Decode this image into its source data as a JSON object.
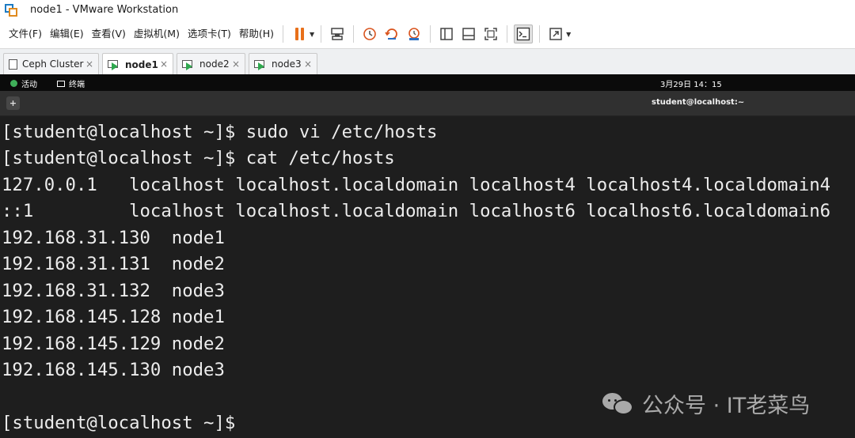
{
  "window": {
    "title": "node1 - VMware Workstation"
  },
  "menu": {
    "items": [
      "文件(F)",
      "编辑(E)",
      "查看(V)",
      "虚拟机(M)",
      "选项卡(T)",
      "帮助(H)"
    ]
  },
  "toolbar": {
    "icons": [
      "pause-icon",
      "send-keys-icon",
      "snapshot-icon",
      "revert-snapshot-icon",
      "snapshot-manager-icon",
      "sidebar-icon",
      "thumbnail-bar-icon",
      "full-screen-icon",
      "console-view-icon",
      "stretch-guest-icon"
    ],
    "accent_color": "#e8701a"
  },
  "tabs": [
    {
      "label": "Ceph Cluster",
      "active": false
    },
    {
      "label": "node1",
      "active": true
    },
    {
      "label": "node2",
      "active": false
    },
    {
      "label": "node3",
      "active": false
    }
  ],
  "tab_close_glyph": "×",
  "guest": {
    "activities_label": "活动",
    "app_label": "终端",
    "clock": "3月29日  14：15"
  },
  "terminal": {
    "title": "student@localhost:~",
    "new_tab_glyph": "+",
    "lines": [
      "[student@localhost ~]$ sudo vi /etc/hosts",
      "[student@localhost ~]$ cat /etc/hosts",
      "127.0.0.1   localhost localhost.localdomain localhost4 localhost4.localdomain4",
      "::1         localhost localhost.localdomain localhost6 localhost6.localdomain6",
      "192.168.31.130  node1",
      "192.168.31.131  node2",
      "192.168.31.132  node3",
      "192.168.145.128 node1",
      "192.168.145.129 node2",
      "192.168.145.130 node3",
      "",
      "[student@localhost ~]$"
    ],
    "background": "#1e1e1e",
    "foreground": "#ececec"
  },
  "watermark": {
    "text": "公众号 · IT老菜鸟"
  }
}
